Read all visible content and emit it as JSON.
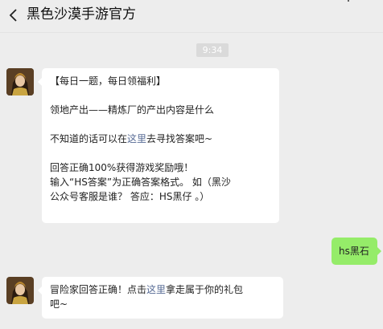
{
  "header": {
    "title": "黑色沙漠手游官方"
  },
  "chat": {
    "timestamp": "9:34",
    "msg1": {
      "line1": "【每日一题，每日领福利】",
      "line2": "领地产出——精炼厂的产出内容是什么",
      "line3_pre": "不知道的话可以在",
      "line3_link": "这里",
      "line3_post": "去寻找答案吧~",
      "line4": "回答正确100%获得游戏奖励哦！",
      "line5": "输入“HS答案”为正确答案格式。 如（黑沙",
      "line6": "公众号客服是谁？ 答应：HS黑仔 。）"
    },
    "msg2": {
      "text": "hs黑石"
    },
    "msg3": {
      "line1_pre": "冒险家回答正确！点击",
      "line1_link": "这里",
      "line1_post": "拿走属于你的礼包",
      "line2": "吧~"
    }
  }
}
